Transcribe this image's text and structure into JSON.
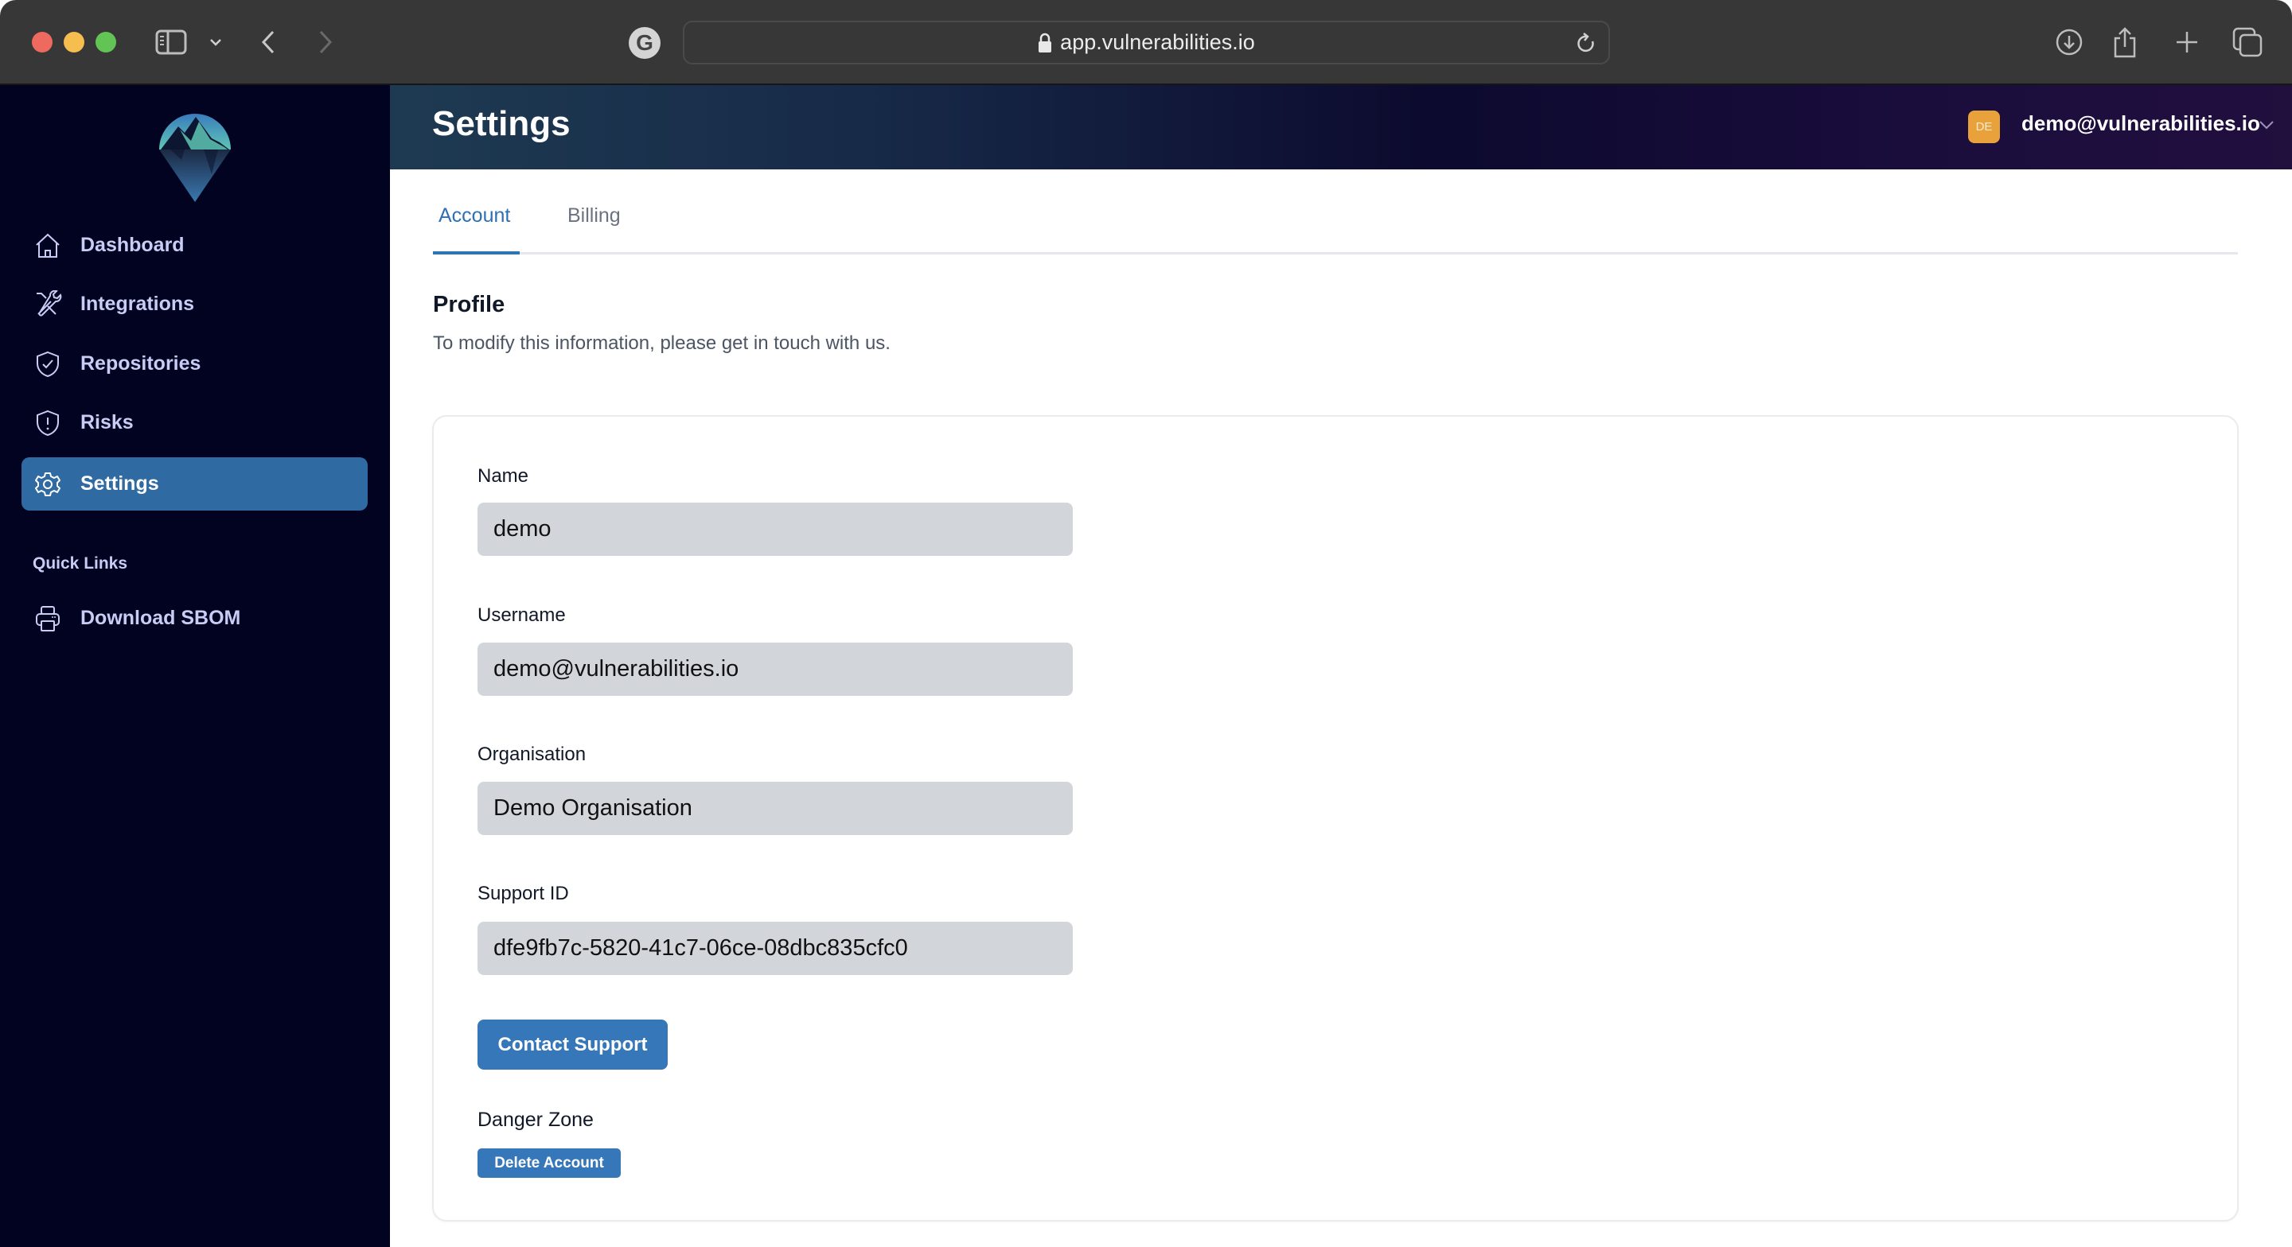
{
  "browser": {
    "url": "app.vulnerabilities.io",
    "extension_label": "G",
    "icons": [
      "sidebar-toggle-icon",
      "chevron-down-icon",
      "back-icon",
      "forward-icon",
      "lock-icon",
      "reload-icon",
      "download-icon",
      "share-icon",
      "new-tab-icon",
      "tab-overview-icon"
    ]
  },
  "sidebar": {
    "items": [
      {
        "label": "Dashboard",
        "icon": "home-icon",
        "active": false
      },
      {
        "label": "Integrations",
        "icon": "tools-icon",
        "active": false
      },
      {
        "label": "Repositories",
        "icon": "shield-check-icon",
        "active": false
      },
      {
        "label": "Risks",
        "icon": "shield-exclamation-icon",
        "active": false
      },
      {
        "label": "Settings",
        "icon": "gear-icon",
        "active": true
      }
    ],
    "quick_links_title": "Quick Links",
    "quick_links": [
      {
        "label": "Download SBOM",
        "icon": "printer-icon"
      }
    ]
  },
  "header": {
    "title": "Settings",
    "user": {
      "initials": "DE",
      "email": "demo@vulnerabilities.io"
    }
  },
  "tabs": [
    {
      "label": "Account",
      "active": true
    },
    {
      "label": "Billing",
      "active": false
    }
  ],
  "profile": {
    "title": "Profile",
    "description": "To modify this information, please get in touch with us.",
    "fields": [
      {
        "label": "Name",
        "value": "demo"
      },
      {
        "label": "Username",
        "value": "demo@vulnerabilities.io"
      },
      {
        "label": "Organisation",
        "value": "Demo Organisation"
      },
      {
        "label": "Support ID",
        "value": "dfe9fb7c-5820-41c7-06ce-08dbc835cfc0"
      }
    ],
    "contact_button": "Contact Support",
    "danger_zone_label": "Danger Zone",
    "delete_button": "Delete Account"
  },
  "colors": {
    "primary": "#3677b9",
    "sidebar_bg": "#020320",
    "sidebar_active": "#2f6aa2",
    "avatar": "#e9a23b",
    "input_bg": "#d2d5da"
  }
}
